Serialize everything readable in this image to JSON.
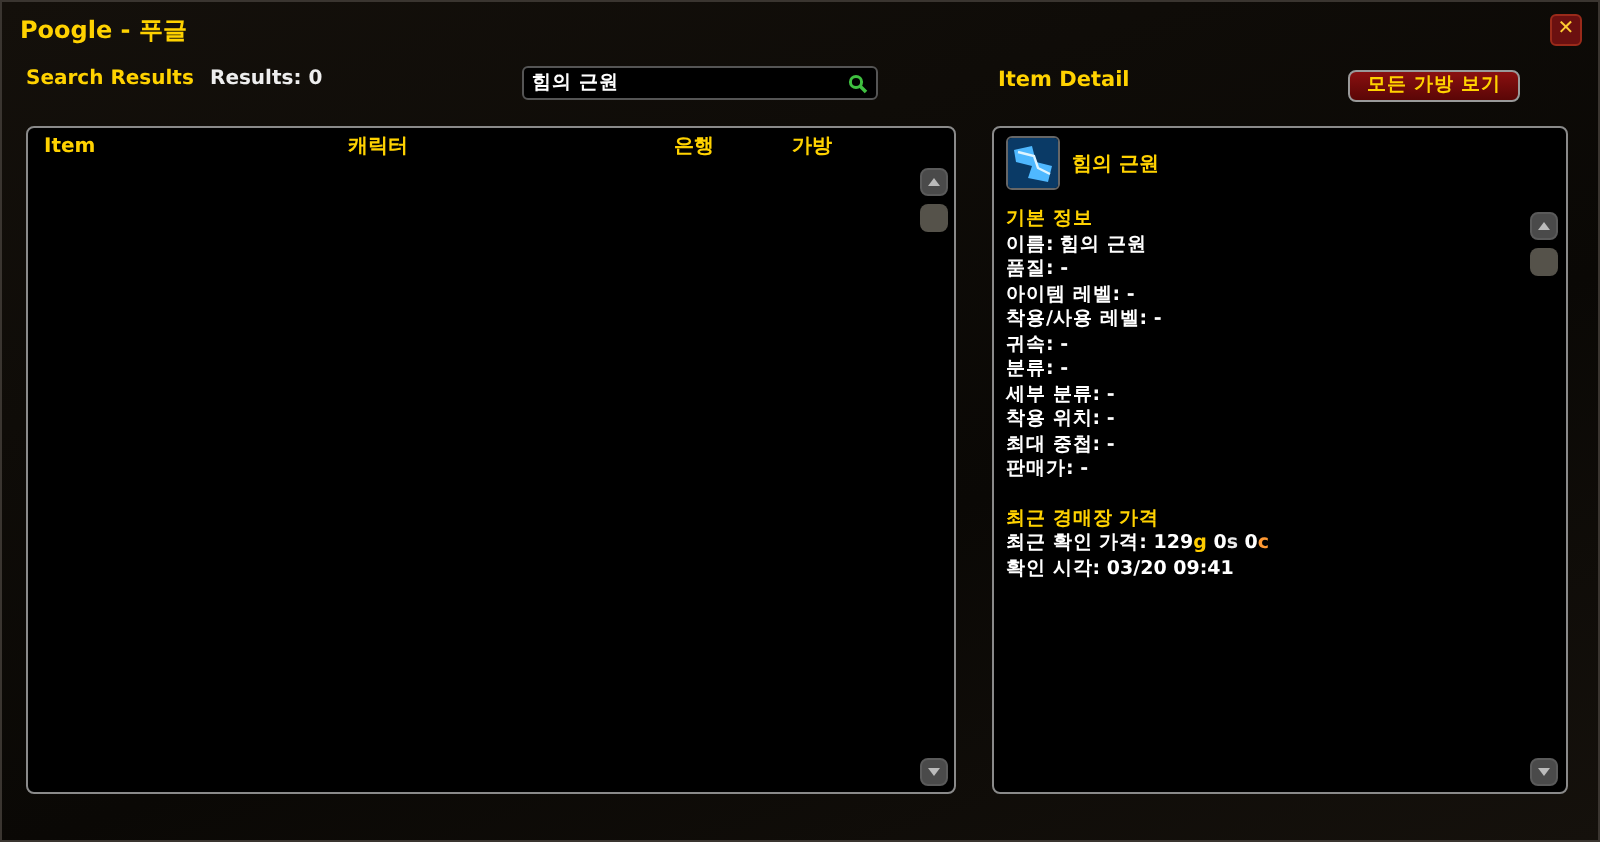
{
  "window": {
    "title": "Poogle - 푸글",
    "close": "✕"
  },
  "search_results": {
    "title": "Search Results",
    "count": "Results: 0",
    "search": {
      "value": "힘의 근원"
    },
    "columns": [
      "Item",
      "캐릭터",
      "은행",
      "가방"
    ]
  },
  "item_detail": {
    "title": "Item Detail",
    "button": "모든 가방 보기",
    "name": "힘의 근원",
    "sections": [
      {
        "heading": "기본 정보",
        "lines": [
          "이름: 힘의 근원",
          "품질: -",
          "아이템 레벨: -",
          "착용/사용 레벨: -",
          "귀속: -",
          "분류: -",
          "세부 분류: -",
          "착용 위치: -",
          "최대 중첩: -",
          "판매가: -"
        ]
      },
      {
        "heading": "최근 경매장 가격",
        "price": {
          "label": "최근 확인 가격:",
          "coins": [
            {
              "amount": "129",
              "unit": "g",
              "color": "#ffcc00"
            },
            {
              "amount": "0",
              "unit": "s",
              "color": "#e8e8e8"
            },
            {
              "amount": "0",
              "unit": "c",
              "color": "#ff9933"
            }
          ]
        },
        "lines": [
          "확인 시각: 03/20 09:41"
        ]
      }
    ]
  }
}
